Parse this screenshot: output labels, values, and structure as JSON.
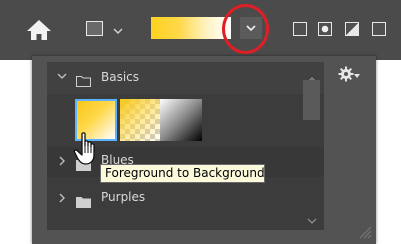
{
  "toolbar": {
    "home_icon": "home-icon",
    "fill_swatch_icon": "fill-swatch-icon",
    "gradient_preview_colors": [
      "#ffd21f",
      "#ffffff"
    ],
    "dropdown_icon": "chevron-down-icon",
    "highlight_color": "#e01e25",
    "gradient_type_icons": [
      "square-icon",
      "radial-square-icon",
      "diagonal-square-icon",
      "square-icon"
    ]
  },
  "panel": {
    "groups": [
      {
        "label": "Basics",
        "expanded": true
      },
      {
        "label": "Blues",
        "expanded": false
      },
      {
        "label": "Purples",
        "expanded": false
      }
    ],
    "presets": [
      {
        "name": "Foreground to Background",
        "selected": true
      },
      {
        "name": "Foreground to Transparent",
        "selected": false
      },
      {
        "name": "Black, White",
        "selected": false
      }
    ],
    "tooltip": "Foreground to Background",
    "menu_icon": "gear-icon"
  }
}
